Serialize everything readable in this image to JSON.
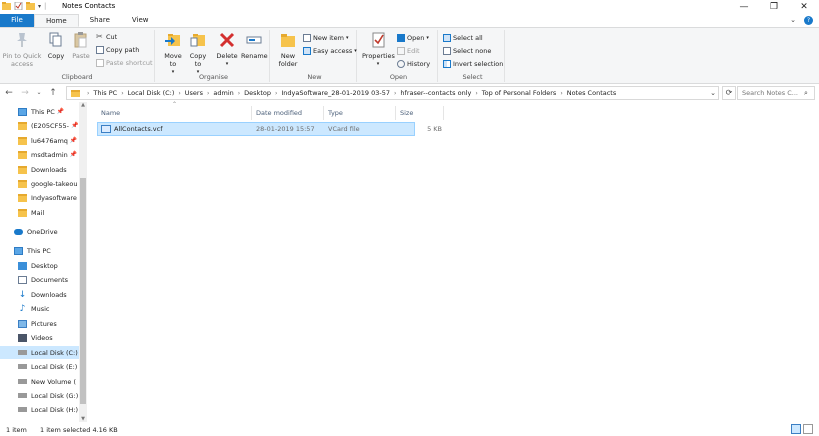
{
  "window": {
    "title": "Notes Contacts",
    "controls": [
      "—",
      "❐",
      "✕"
    ]
  },
  "tabs": [
    {
      "label": "File"
    },
    {
      "label": "Home"
    },
    {
      "label": "Share"
    },
    {
      "label": "View"
    }
  ],
  "ribbon": {
    "clipboard": {
      "label": "Clipboard",
      "pin_to_quick_access": "Pin to Quick access",
      "copy": "Copy",
      "paste": "Paste",
      "cut": "Cut",
      "copy_path": "Copy path",
      "paste_shortcut": "Paste shortcut"
    },
    "organise": {
      "label": "Organise",
      "move_to": "Move to",
      "copy_to": "Copy to",
      "delete": "Delete",
      "rename": "Rename"
    },
    "new": {
      "label": "New",
      "new_folder": "New folder",
      "new_item": "New item",
      "easy_access": "Easy access"
    },
    "open": {
      "label": "Open",
      "properties": "Properties",
      "open": "Open",
      "edit": "Edit",
      "history": "History"
    },
    "select": {
      "label": "Select",
      "select_all": "Select all",
      "select_none": "Select none",
      "invert_selection": "Invert selection"
    }
  },
  "address": {
    "crumbs": [
      "This PC",
      "Local Disk (C:)",
      "Users",
      "admin",
      "Desktop",
      "IndyaSoftware_28-01-2019 03-57",
      "hfraser--contacts only",
      "Top of Personal Folders",
      "Notes Contacts"
    ],
    "search_placeholder": "Search Notes C..."
  },
  "navpane": {
    "quick": [
      {
        "label": "This PC",
        "pinned": true
      },
      {
        "label": "(E205CF55-",
        "pinned": true
      },
      {
        "label": "lu6476amq",
        "pinned": true
      },
      {
        "label": "msdtadmin",
        "pinned": true
      },
      {
        "label": "Downloads",
        "pinned": false
      },
      {
        "label": "google-takeou",
        "pinned": false
      },
      {
        "label": "Indyasoftware",
        "pinned": false
      },
      {
        "label": "Mail",
        "pinned": false
      }
    ],
    "onedrive": "OneDrive",
    "thispc": "This PC",
    "pc_items": [
      "Desktop",
      "Documents",
      "Downloads",
      "Music",
      "Pictures",
      "Videos",
      "Local Disk (C:)",
      "Local Disk (E:)",
      "New Volume (",
      "Local Disk (G:)",
      "Local Disk (H:)"
    ]
  },
  "columns": {
    "name": "Name",
    "date": "Date modified",
    "type": "Type",
    "size": "Size"
  },
  "files": [
    {
      "name": "AllContacts.vcf",
      "date": "28-01-2019 15:57",
      "type": "VCard file",
      "size": "5 KB"
    }
  ],
  "status": {
    "items": "1 item",
    "selected": "1 item selected  4.16 KB"
  }
}
